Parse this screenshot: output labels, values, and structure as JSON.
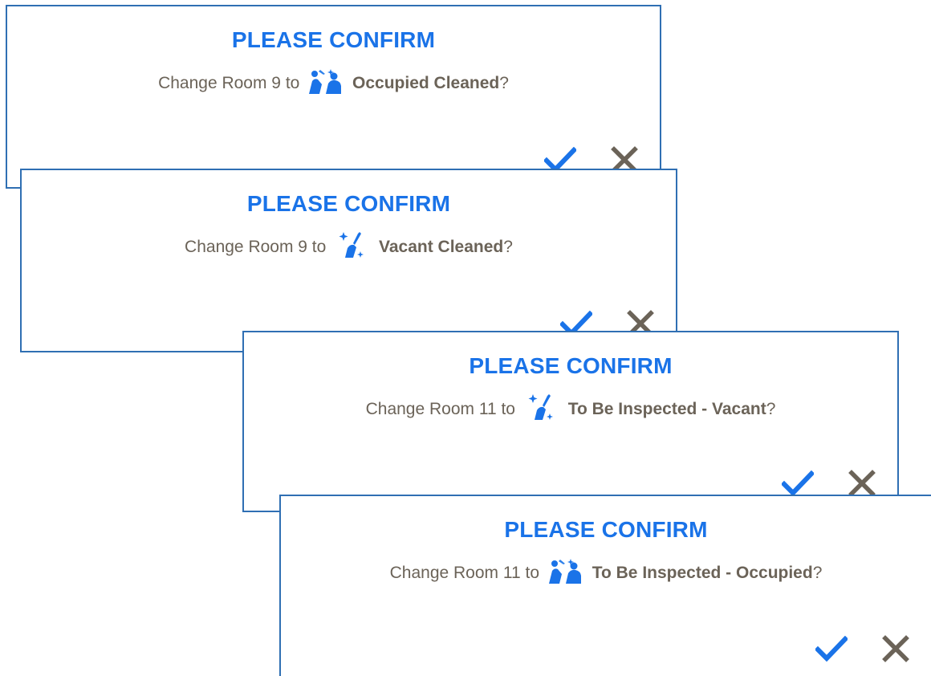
{
  "colors": {
    "accent": "#1a73e8",
    "text": "#6b6358",
    "border": "#2f6fb3",
    "cancel": "#6b6358"
  },
  "dialogs": [
    {
      "title": "PLEASE CONFIRM",
      "prefix": "Change Room 9 to",
      "status": "Occupied Cleaned",
      "suffix": "?",
      "icon": "occupied-cleaned-icon"
    },
    {
      "title": "PLEASE CONFIRM",
      "prefix": "Change Room 9 to",
      "status": "Vacant Cleaned",
      "suffix": "?",
      "icon": "vacant-cleaned-icon"
    },
    {
      "title": "PLEASE CONFIRM",
      "prefix": "Change Room 11 to",
      "status": "To Be Inspected - Vacant",
      "suffix": "?",
      "icon": "vacant-cleaned-icon"
    },
    {
      "title": "PLEASE CONFIRM",
      "prefix": "Change Room 11 to",
      "status": "To Be Inspected - Occupied",
      "suffix": "?",
      "icon": "occupied-cleaned-icon"
    }
  ]
}
